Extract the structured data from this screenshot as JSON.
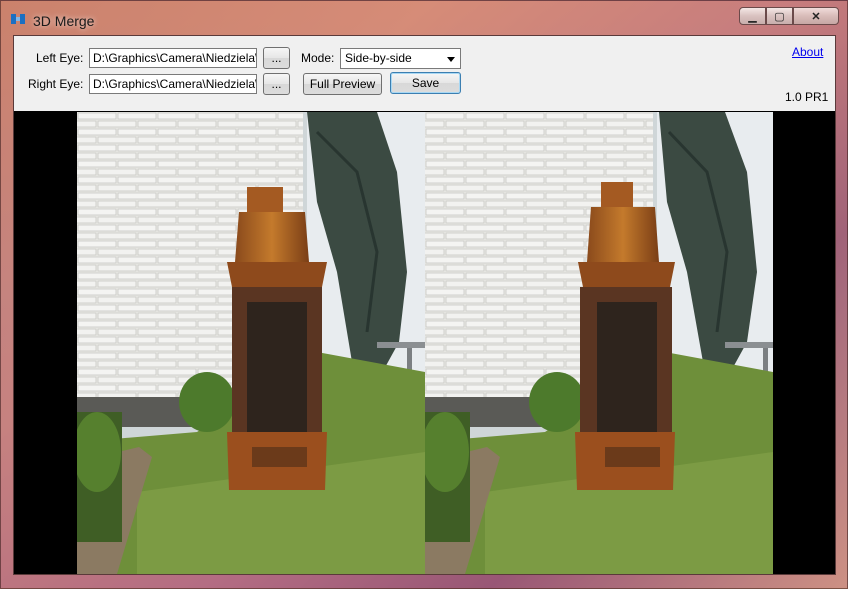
{
  "window": {
    "title": "3D Merge"
  },
  "caption_buttons": {
    "minimize": "▁",
    "maximize": "▢",
    "close": "✕"
  },
  "toolbar": {
    "left_eye_label": "Left Eye:",
    "left_eye_value": "D:\\Graphics\\Camera\\Niedziela\\ko",
    "right_eye_label": "Right Eye:",
    "right_eye_value": "D:\\Graphics\\Camera\\Niedziela\\ko",
    "browse_label": "...",
    "mode_label": "Mode:",
    "mode_value": "Side-by-side",
    "full_preview_label": "Full Preview",
    "save_label": "Save",
    "about_label": "About",
    "version": "1.0 PR1"
  },
  "preview": {
    "description_icon": "stereo-photo",
    "left_image": "left-eye-photo",
    "right_image": "right-eye-photo"
  }
}
